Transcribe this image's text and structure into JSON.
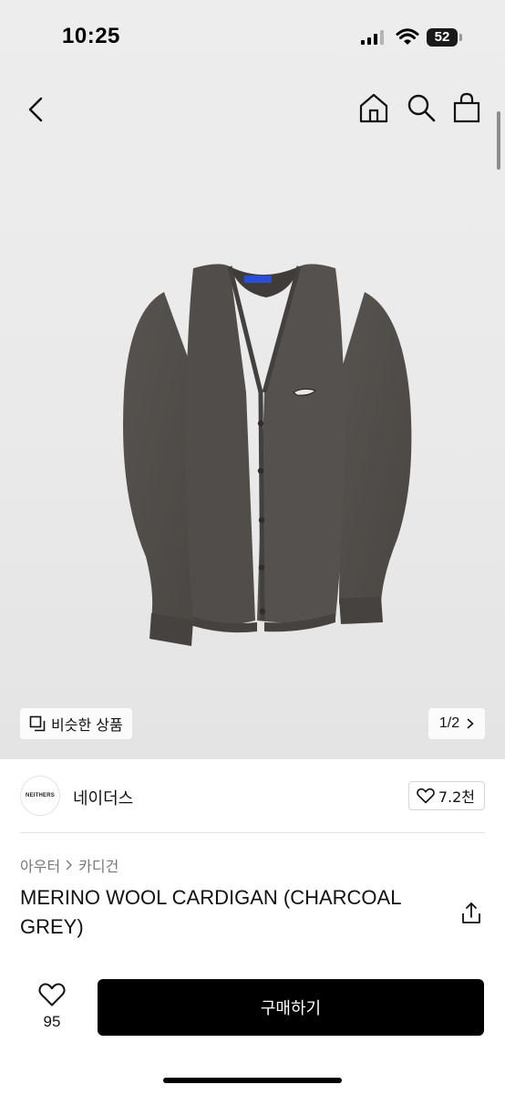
{
  "status_bar": {
    "time": "10:25",
    "battery": "52"
  },
  "nav": {
    "back_icon": "chevron-left-icon",
    "home_icon": "home-icon",
    "search_icon": "search-icon",
    "cart_icon": "shopping-bag-icon"
  },
  "gallery": {
    "similar_label": "비슷한 상품",
    "page_indicator": "1/2"
  },
  "brand": {
    "logo_text": "NEITHERS",
    "name": "네이더스",
    "like_count": "7.2천"
  },
  "product": {
    "breadcrumb": [
      "아우터",
      "카디건"
    ],
    "title": "MERINO WOOL CARDIGAN (CHARCOAL GREY)"
  },
  "bottom": {
    "wish_count": "95",
    "buy_label": "구매하기"
  },
  "colors": {
    "accent": "#000000",
    "product": "#4f4b48",
    "background": "#ededed"
  }
}
